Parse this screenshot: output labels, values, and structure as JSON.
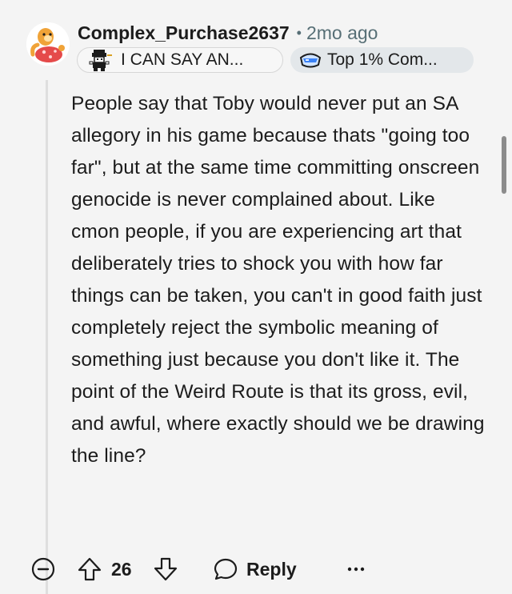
{
  "comment": {
    "author": "Complex_Purchase2637",
    "separator": "•",
    "timestamp": "2mo ago",
    "user_flair": {
      "icon": "pixel-character-sprite-icon",
      "text": "I CAN SAY AN..."
    },
    "achievement_flair": {
      "icon": "visor-badge-icon",
      "text": "Top 1% Com..."
    },
    "avatar": "orange-shellfish-avatar",
    "body": "People say that Toby would never put an SA allegory in his game because thats \"going too far\", but at the same time committing onscreen genocide is never complained about. Like cmon people, if you are experiencing art that deliberately tries to shock you with how far things can be taken, you can't in good faith just completely reject the symbolic meaning of something just because you don't like it. The point of the Weird Route is that its gross, evil, and awful, where exactly should we be drawing the line?",
    "score": "26",
    "reply_label": "Reply",
    "more_label": "···"
  },
  "icons": {
    "collapse": "collapse-minus-icon",
    "upvote": "upvote-arrow-icon",
    "downvote": "downvote-arrow-icon",
    "reply": "reply-bubble-icon",
    "more": "more-options-icon"
  },
  "colors": {
    "background": "#f4f4f4",
    "text": "#1c1c1c",
    "meta": "#576f76",
    "thread_line": "#dedede",
    "achievement_flair_bg": "#e3e7ea",
    "avatar_shell": "#e54a4a",
    "avatar_body": "#f0a338"
  }
}
